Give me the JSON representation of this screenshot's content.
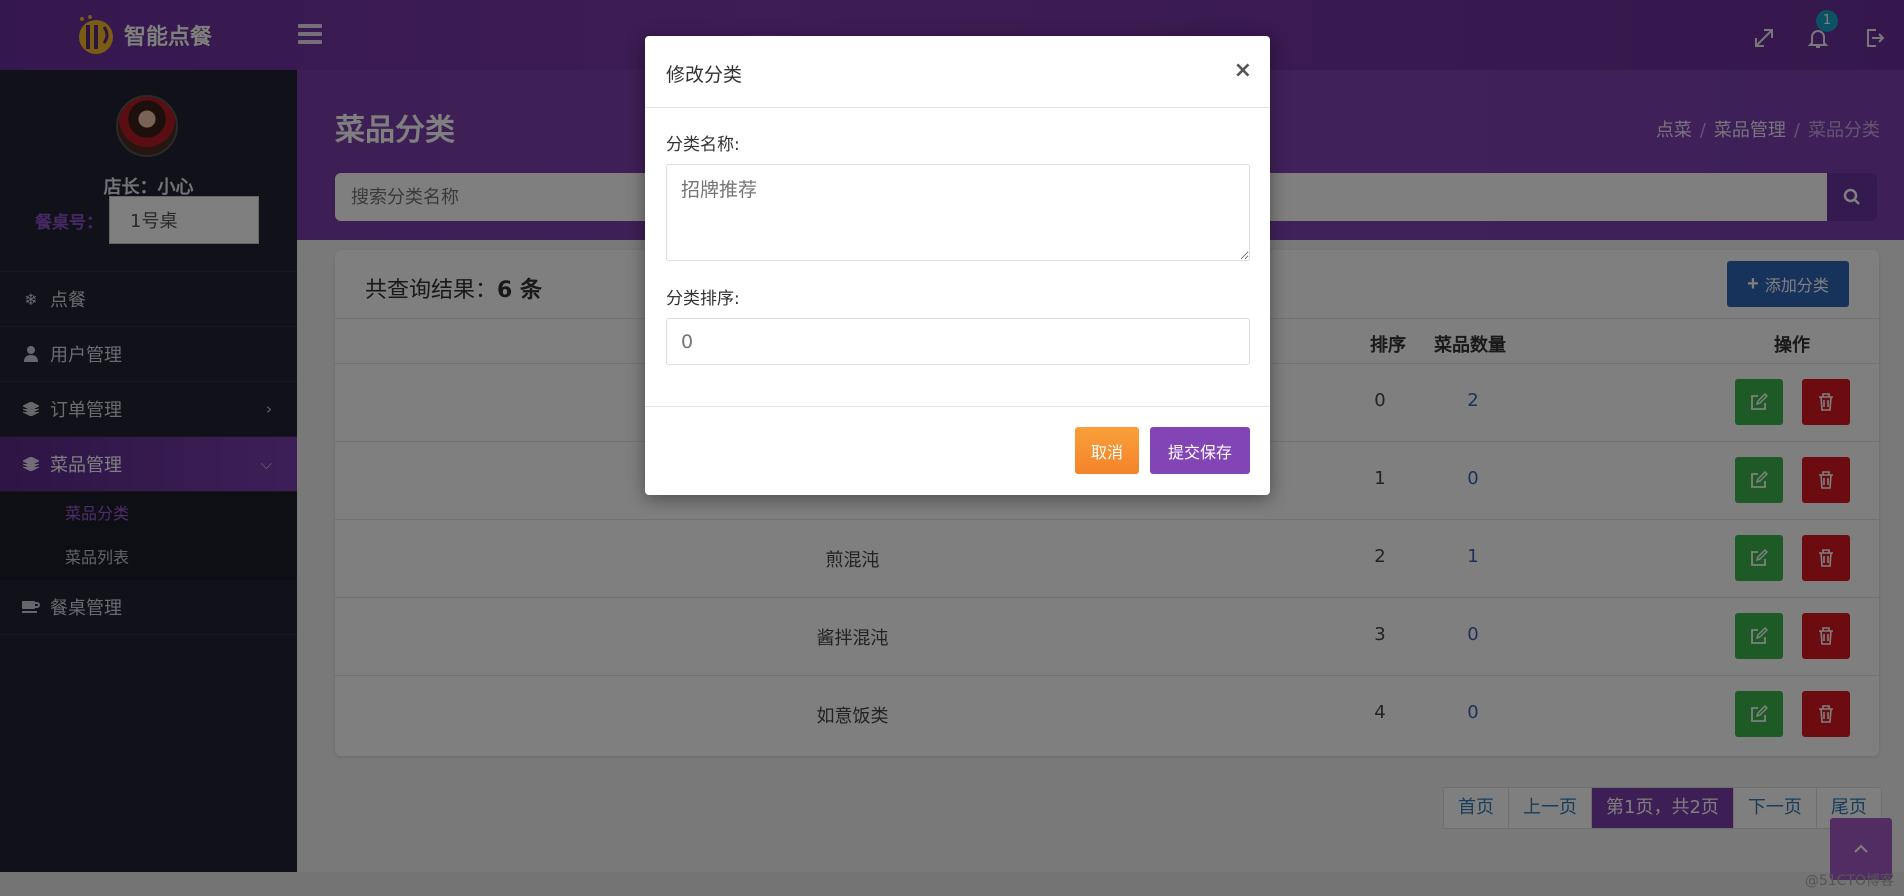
{
  "app": {
    "logo_text": "智能点餐",
    "notification_count": "1"
  },
  "sidebar": {
    "owner": "店长：小心",
    "table_label": "餐桌号：",
    "table_value": "1号桌",
    "items": [
      {
        "label": "点餐",
        "icon": "snowflake-icon"
      },
      {
        "label": "用户管理",
        "icon": "user-icon"
      },
      {
        "label": "订单管理",
        "icon": "layers-icon"
      },
      {
        "label": "菜品管理",
        "icon": "layers-icon"
      },
      {
        "label": "餐桌管理",
        "icon": "coffee-icon"
      }
    ],
    "subitems": [
      {
        "label": "菜品分类"
      },
      {
        "label": "菜品列表"
      }
    ]
  },
  "page": {
    "title": "菜品分类",
    "breadcrumb": [
      "点菜",
      "菜品管理",
      "菜品分类"
    ],
    "search_placeholder": "搜索分类名称"
  },
  "panel": {
    "result_prefix": "共查询结果：",
    "result_count": "6 条",
    "add_label": "添加分类",
    "columns": {
      "sort": "排序",
      "count": "菜品数量",
      "ops": "操作"
    },
    "rows": [
      {
        "name": "",
        "sort": "0",
        "count": "2"
      },
      {
        "name": "",
        "sort": "1",
        "count": "0"
      },
      {
        "name": "煎混沌",
        "sort": "2",
        "count": "1"
      },
      {
        "name": "酱拌混沌",
        "sort": "3",
        "count": "0"
      },
      {
        "name": "如意饭类",
        "sort": "4",
        "count": "0"
      }
    ]
  },
  "pager": {
    "first": "首页",
    "prev": "上一页",
    "current": "第1页，共2页",
    "next": "下一页",
    "last": "尾页"
  },
  "watermark": "@51CTO博客",
  "modal": {
    "title": "修改分类",
    "close": "×",
    "name_label": "分类名称:",
    "name_value": "招牌推荐",
    "sort_label": "分类排序:",
    "sort_value": "0",
    "cancel": "取消",
    "save": "提交保存"
  },
  "colors": {
    "brand": "#7a3caa",
    "edit": "#3cb54a",
    "delete": "#d81820",
    "cancel": "#f4832a",
    "add": "#2e66b8"
  }
}
